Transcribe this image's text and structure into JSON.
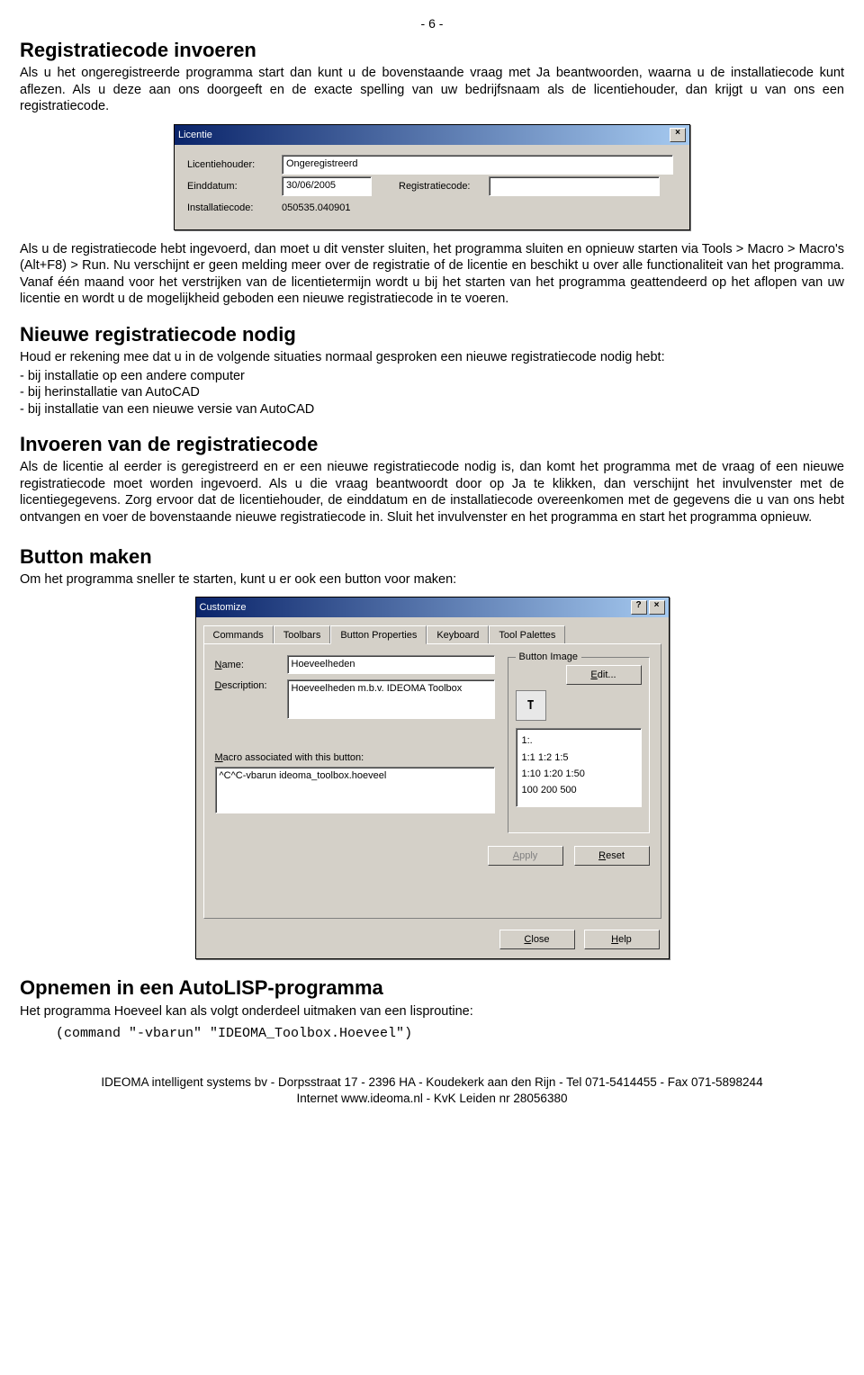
{
  "page_number": "- 6 -",
  "section1": {
    "title": "Registratiecode invoeren",
    "p1": "Als u het ongeregistreerde programma start dan kunt u de bovenstaande vraag met Ja beantwoorden, waarna u de installatiecode kunt aflezen. Als u deze aan ons doorgeeft en de exacte spelling van uw bedrijfsnaam als de licentiehouder, dan krijgt u van ons een registratiecode."
  },
  "licentie_dialog": {
    "title": "Licentie",
    "labels": {
      "houder": "Licentiehouder:",
      "einddatum": "Einddatum:",
      "regcode": "Registratiecode:",
      "instcode": "Installatiecode:"
    },
    "values": {
      "houder": "Ongeregistreerd",
      "einddatum": "30/06/2005",
      "regcode": "",
      "instcode": "050535.040901"
    }
  },
  "section1b": {
    "p2": "Als u de registratiecode hebt ingevoerd, dan moet u dit venster sluiten, het programma sluiten en opnieuw starten via Tools > Macro > Macro's (Alt+F8) > Run. Nu verschijnt er geen melding meer over de registratie of de licentie en beschikt u over alle functionaliteit van het programma. Vanaf één maand voor het verstrijken van de licentietermijn wordt u bij het starten van het programma geattendeerd op het aflopen van uw licentie en wordt u de mogelijkheid geboden een nieuwe registratiecode in te voeren."
  },
  "section2": {
    "title": "Nieuwe registratiecode nodig",
    "intro": "Houd er rekening mee dat u in de volgende situaties normaal gesproken een nieuwe registratiecode nodig hebt:",
    "items": [
      "- bij installatie op een andere computer",
      "- bij herinstallatie van AutoCAD",
      "- bij installatie van een nieuwe versie van AutoCAD"
    ]
  },
  "section3": {
    "title": "Invoeren van de registratiecode",
    "p": "Als de licentie al eerder is geregistreerd en er een nieuwe registratiecode nodig is, dan komt het programma met de vraag of een nieuwe registratiecode moet worden ingevoerd. Als u die vraag beantwoordt door op Ja te klikken, dan verschijnt het invulvenster met de licentiegegevens. Zorg ervoor dat de licentiehouder, de einddatum en de installatiecode overeenkomen met de gegevens die u van ons hebt ontvangen en voer de bovenstaande nieuwe registratiecode in. Sluit het invulvenster en het programma en start het programma opnieuw."
  },
  "section4": {
    "title": "Button maken",
    "p": "Om het programma sneller te starten, kunt u er ook een button voor maken:"
  },
  "customize_dialog": {
    "title": "Customize",
    "tabs": [
      "Commands",
      "Toolbars",
      "Button Properties",
      "Keyboard",
      "Tool Palettes"
    ],
    "active_tab": "Button Properties",
    "name_label": "Name:",
    "name_value": "Hoeveelheden",
    "desc_label": "Description:",
    "desc_value": "Hoeveelheden m.b.v. IDEOMA Toolbox",
    "macro_label": "Macro associated with this button:",
    "macro_value": "^C^C-vbarun ideoma_toolbox.hoeveel",
    "button_image_label": "Button Image",
    "edit": "Edit...",
    "image_list": [
      "1:.",
      "1:1   1:2   1:5",
      "1:10  1:20  1:50",
      "100   200   500"
    ],
    "icon_char": "T",
    "apply": "Apply",
    "reset": "Reset",
    "close": "Close",
    "help": "Help"
  },
  "section5": {
    "title": "Opnemen in een AutoLISP-programma",
    "p": "Het programma Hoeveel kan als volgt onderdeel uitmaken van een lisproutine:",
    "code": "(command \"-vbarun\" \"IDEOMA_Toolbox.Hoeveel\")"
  },
  "footer": {
    "line1": "IDEOMA intelligent systems bv - Dorpsstraat 17 - 2396 HA - Koudekerk aan den Rijn - Tel 071-5414455 - Fax 071-5898244",
    "line2": "Internet www.ideoma.nl - KvK Leiden nr 28056380"
  }
}
